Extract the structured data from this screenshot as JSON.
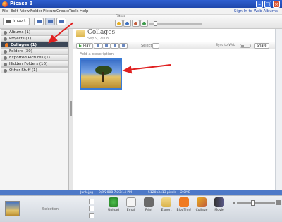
{
  "window": {
    "title": "Picasa 3"
  },
  "menu": {
    "items": [
      "File",
      "Edit",
      "View",
      "Folder",
      "Picture",
      "Create",
      "Tools",
      "Help"
    ],
    "sign_in": "Sign In to Web Albums"
  },
  "toolbar": {
    "import_label": "Import",
    "filters_label": "Filters"
  },
  "library": {
    "rows": [
      {
        "label": "Albums (1)",
        "state": "collapsed"
      },
      {
        "label": "Projects (1)",
        "state": "expanded"
      },
      {
        "label": "Collages (1)",
        "state": "selected"
      },
      {
        "label": "Folders (30)",
        "state": "collapsed"
      },
      {
        "label": "Exported Pictures (1)",
        "state": "collapsed"
      },
      {
        "label": "Hidden Folders (16)",
        "state": "collapsed"
      },
      {
        "label": "Other Stuff (1)",
        "state": "collapsed"
      }
    ]
  },
  "main": {
    "folder_title": "Collages",
    "folder_date": "Sep 9, 2008",
    "play_label": "Play",
    "select_label": "Select",
    "sync_label": "Sync to Web",
    "share_label": "Share",
    "add_description": "Add a description"
  },
  "status": {
    "filename": "Junk.jpg",
    "datetime": "9/9/2008 7:23:14 PM",
    "dimensions": "5120x3413 pixels",
    "filesize": "2.0MB"
  },
  "tray": {
    "selection_label": "Selection",
    "actions": [
      "Upload",
      "Email",
      "Print",
      "Export",
      "BlogThis!",
      "Collage",
      "Movie"
    ]
  },
  "colors": {
    "titlebar": "#2f5fd0",
    "selected_row": "#3b4656",
    "annotation_arrow": "#e02020",
    "status_bar": "#4d79c8"
  }
}
